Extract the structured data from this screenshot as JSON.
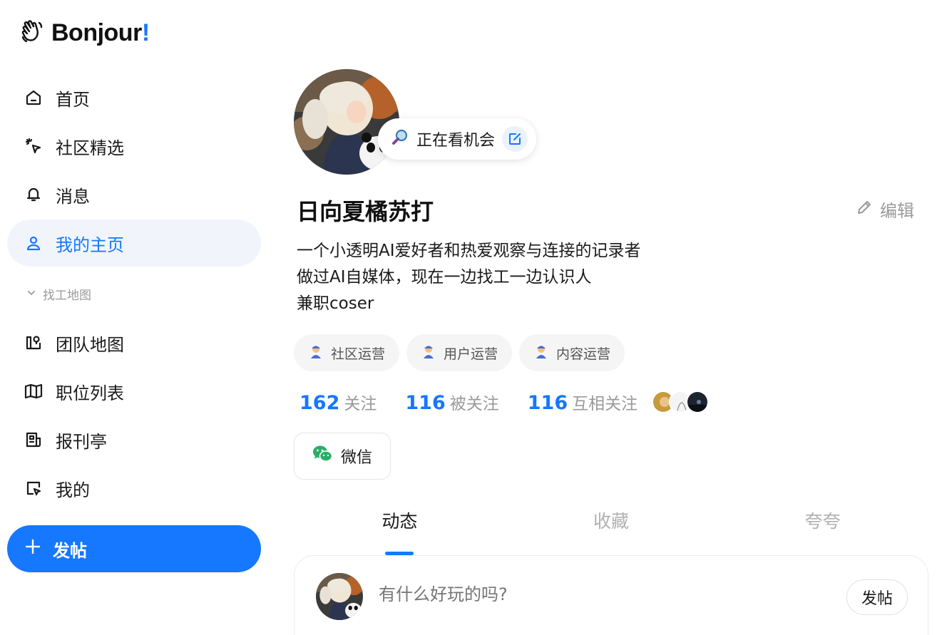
{
  "brand": {
    "name": "Bonjour",
    "bang": "!",
    "logo_icon": "waving-hand-icon",
    "accent": "#1677ff"
  },
  "sidebar": {
    "items": [
      {
        "label": "首页",
        "icon": "home-icon"
      },
      {
        "label": "社区精选",
        "icon": "sparkle-cursor-icon"
      },
      {
        "label": "消息",
        "icon": "bell-icon"
      },
      {
        "label": "我的主页",
        "icon": "user-icon",
        "active": true
      }
    ],
    "section_label": "找工地图",
    "section_items": [
      {
        "label": "团队地图",
        "icon": "team-map-icon"
      },
      {
        "label": "职位列表",
        "icon": "map-icon"
      },
      {
        "label": "报刊亭",
        "icon": "newspaper-icon"
      },
      {
        "label": "我的",
        "icon": "note-edit-icon"
      }
    ],
    "post_button": "发帖"
  },
  "profile": {
    "status": "正在看机会",
    "name": "日向夏橘苏打",
    "edit_label": "编辑",
    "bio": [
      "一个小透明AI爱好者和热爱观察与连接的记录者",
      "做过AI自媒体，现在一边找工一边认识人",
      "兼职coser"
    ],
    "tags": [
      "社区运营",
      "用户运营",
      "内容运营"
    ],
    "stats": [
      {
        "num": "162",
        "label": "关注"
      },
      {
        "num": "116",
        "label": "被关注"
      },
      {
        "num": "116",
        "label": "互相关注"
      }
    ],
    "wechat_label": "微信"
  },
  "tabs": [
    "动态",
    "收藏",
    "夸夸"
  ],
  "composer": {
    "placeholder": "有什么好玩的吗?",
    "post_label": "发帖"
  }
}
